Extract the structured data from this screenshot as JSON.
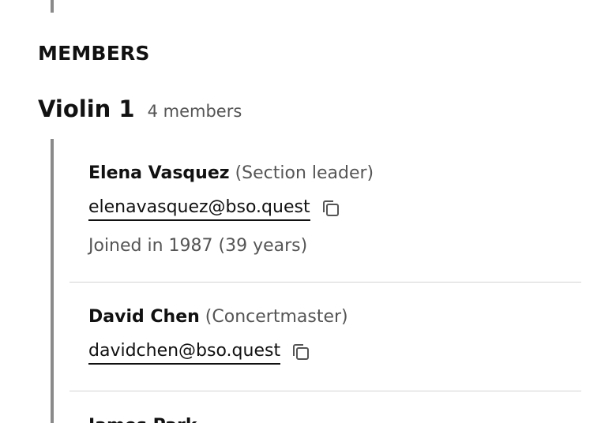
{
  "section": {
    "heading": "MEMBERS"
  },
  "group": {
    "title": "Violin 1",
    "count": "4 members"
  },
  "members": [
    {
      "name": "Elena Vasquez",
      "role": "(Section leader)",
      "email": "elenavasquez@bso.quest",
      "joined": "Joined in 1987 (39 years)",
      "copy_icon": "copy-icon"
    },
    {
      "name": "David Chen",
      "role": "(Concertmaster)",
      "email": "davidchen@bso.quest",
      "copy_icon": "copy-icon"
    },
    {
      "name": "James Park"
    }
  ],
  "colors": {
    "text": "#111111",
    "muted": "#555555",
    "rule": "#8a8a8a",
    "divider": "#d4d4d4"
  }
}
